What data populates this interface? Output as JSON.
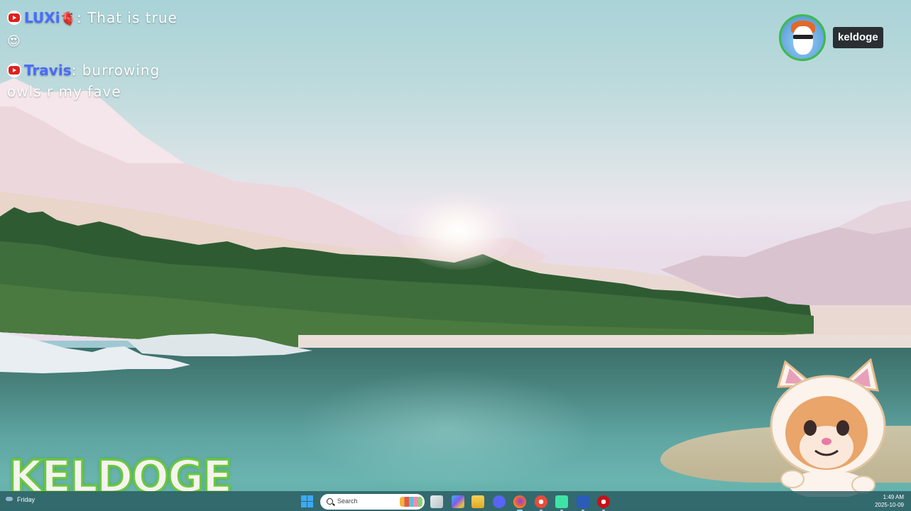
{
  "chat": {
    "messages": [
      {
        "author": "LUXi",
        "badge_emoji": "🫀",
        "separator": ":",
        "text": " That is true",
        "emoji": "😍"
      },
      {
        "author": "Travis",
        "separator": ":",
        "text": " burrowing owls r my fave"
      }
    ]
  },
  "streamer": {
    "avatar": "fox-avatar-icon",
    "name": "keldoge",
    "accent_color": "#3dbb47"
  },
  "logo": {
    "text": "KELDOGE",
    "outline_color": "#69c93a"
  },
  "taskbar": {
    "weather_label": "Friday",
    "search_placeholder": "Search",
    "apps": [
      "file-explorer-icon",
      "copilot-icon",
      "folder-icon",
      "discord-icon",
      "firefox-icon",
      "chrome-icon",
      "streamlabs-icon",
      "word-icon",
      "youtube-icon"
    ],
    "time": "1:49 AM",
    "date": "2025-10-09"
  }
}
